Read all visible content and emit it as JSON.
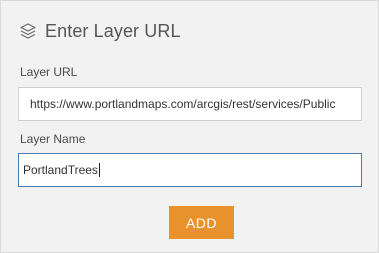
{
  "header": {
    "icon": "layers-icon",
    "title": "Enter Layer URL"
  },
  "form": {
    "url_label": "Layer URL",
    "url_value": "https://www.portlandmaps.com/arcgis/rest/services/Public",
    "name_label": "Layer Name",
    "name_value": "PortlandTrees"
  },
  "actions": {
    "add_label": "ADD"
  },
  "colors": {
    "panel_bg": "#f2f2f2",
    "accent": "#e8922e",
    "focus_border": "#4a7bb5"
  }
}
